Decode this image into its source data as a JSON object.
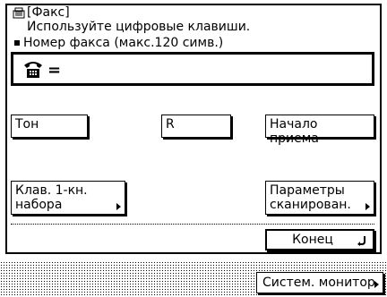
{
  "header": {
    "mode_title": "[Факс]",
    "instruction": "Используйте цифровые клавиши.",
    "field_label": "Номер факса (макс.120 симв.)",
    "icon": "fax-mode-icon"
  },
  "fax_field": {
    "prefix_symbol": "=",
    "value": "",
    "icon": "phone-icon"
  },
  "buttons": {
    "tone": "Тон",
    "r": "R",
    "start_receive": "Начало приема",
    "one_touch_line1": "Клав. 1-кн.",
    "one_touch_line2": "набора",
    "scan_params_line1": "Параметры",
    "scan_params_line2": "сканирован.",
    "done": "Конец",
    "system_monitor": "Систем. монитор"
  }
}
